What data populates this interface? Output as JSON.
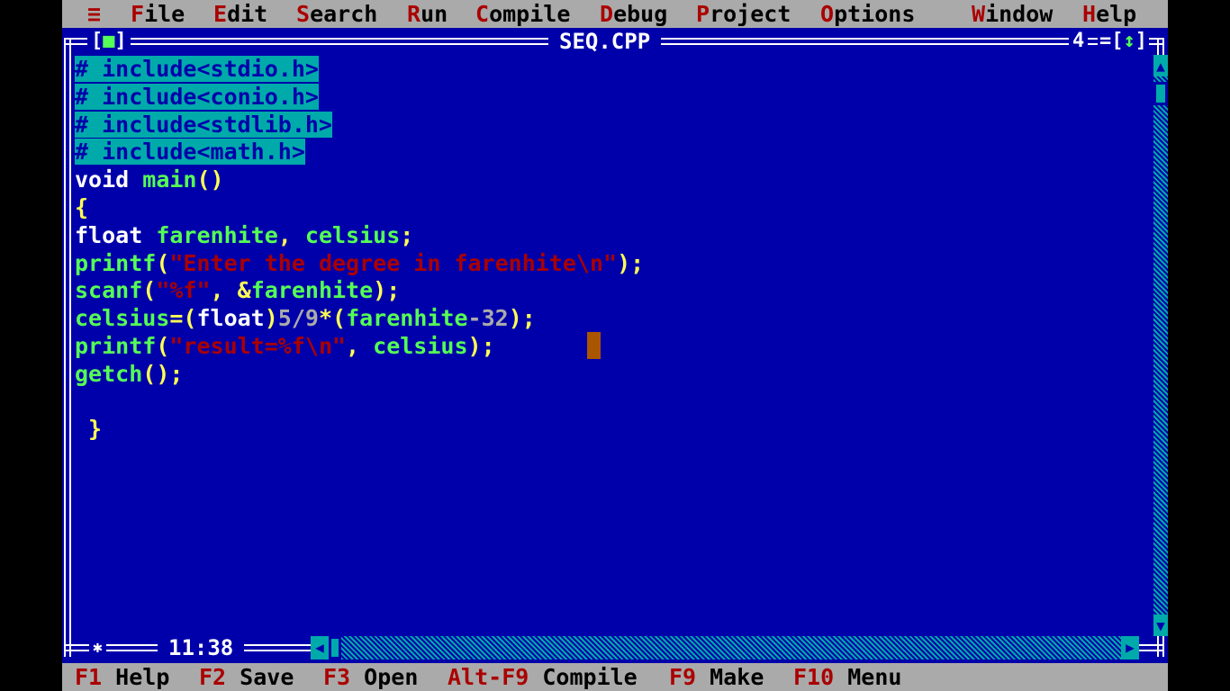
{
  "menu": {
    "system": "≡",
    "items": [
      {
        "hotkey": "F",
        "rest": "ile"
      },
      {
        "hotkey": "E",
        "rest": "dit"
      },
      {
        "hotkey": "S",
        "rest": "earch"
      },
      {
        "hotkey": "R",
        "rest": "un"
      },
      {
        "hotkey": "C",
        "rest": "ompile"
      },
      {
        "hotkey": "D",
        "rest": "ebug"
      },
      {
        "hotkey": "P",
        "rest": "roject"
      },
      {
        "hotkey": "O",
        "rest": "ptions"
      },
      {
        "hotkey": "W",
        "rest": "indow"
      },
      {
        "hotkey": "H",
        "rest": "elp"
      }
    ]
  },
  "window": {
    "title": "SEQ.CPP",
    "close_box_left": "[",
    "close_box_glyph": "■",
    "close_box_right": "]",
    "number": "4",
    "zoom_left": "=[",
    "zoom_glyph": "↕",
    "zoom_right": "]",
    "cursor_position": "11:38",
    "modified_mark": "✱"
  },
  "code": {
    "lines": [
      [
        {
          "t": "# include<stdio.h>",
          "c": "sel"
        }
      ],
      [
        {
          "t": "# include<conio.h>",
          "c": "sel"
        }
      ],
      [
        {
          "t": "# include<stdlib.h>",
          "c": "sel"
        }
      ],
      [
        {
          "t": "# include<math.h>",
          "c": "sel"
        }
      ],
      [
        {
          "t": "void",
          "c": "kw"
        },
        {
          "t": " ",
          "c": "kw"
        },
        {
          "t": "main",
          "c": "id"
        },
        {
          "t": "()",
          "c": "pn"
        }
      ],
      [
        {
          "t": "{",
          "c": "pn"
        }
      ],
      [
        {
          "t": "float",
          "c": "kw"
        },
        {
          "t": " ",
          "c": "kw"
        },
        {
          "t": "farenhite",
          "c": "id"
        },
        {
          "t": ", ",
          "c": "pn"
        },
        {
          "t": "celsius",
          "c": "id"
        },
        {
          "t": ";",
          "c": "pn"
        }
      ],
      [
        {
          "t": "printf",
          "c": "id"
        },
        {
          "t": "(",
          "c": "pn"
        },
        {
          "t": "\"Enter the degree in farenhite\\n\"",
          "c": "st"
        },
        {
          "t": ");",
          "c": "pn"
        }
      ],
      [
        {
          "t": "scanf",
          "c": "id"
        },
        {
          "t": "(",
          "c": "pn"
        },
        {
          "t": "\"%f\"",
          "c": "st"
        },
        {
          "t": ", &",
          "c": "pn"
        },
        {
          "t": "farenhite",
          "c": "id"
        },
        {
          "t": ");",
          "c": "pn"
        }
      ],
      [
        {
          "t": "celsius",
          "c": "id"
        },
        {
          "t": "=(",
          "c": "pn"
        },
        {
          "t": "float",
          "c": "kw"
        },
        {
          "t": ")",
          "c": "pn"
        },
        {
          "t": "5/9",
          "c": "nm"
        },
        {
          "t": "*(",
          "c": "pn"
        },
        {
          "t": "farenhite",
          "c": "id"
        },
        {
          "t": "-32",
          "c": "nm"
        },
        {
          "t": ");",
          "c": "pn"
        }
      ],
      [
        {
          "t": "printf",
          "c": "id"
        },
        {
          "t": "(",
          "c": "pn"
        },
        {
          "t": "\"result=%f\\n\"",
          "c": "st"
        },
        {
          "t": ", ",
          "c": "pn"
        },
        {
          "t": "celsius",
          "c": "id"
        },
        {
          "t": ");",
          "c": "pn"
        }
      ],
      [
        {
          "t": "getch",
          "c": "id"
        },
        {
          "t": "();",
          "c": "pn"
        }
      ],
      [],
      [
        {
          "t": " }",
          "c": "pn"
        }
      ]
    ]
  },
  "fkeys": [
    {
      "key": "F1",
      "label": "Help"
    },
    {
      "key": "F2",
      "label": "Save"
    },
    {
      "key": "F3",
      "label": "Open"
    },
    {
      "key": "Alt-F9",
      "label": "Compile"
    },
    {
      "key": "F9",
      "label": "Make"
    },
    {
      "key": "F10",
      "label": "Menu"
    }
  ],
  "colors": {
    "background": "#0000aa",
    "menu_bar": "#aaaaaa",
    "hotkey": "#aa0000",
    "selection": "#00aaaa",
    "keyword": "#ffffff",
    "identifier": "#55ff55",
    "punctuation": "#ffff55",
    "string": "#aa0000",
    "number": "#aaaaaa",
    "caret": "#aa5500"
  },
  "scrollbar_icons": {
    "up": "arrow-up-icon",
    "down": "arrow-down-icon",
    "left": "arrow-left-icon",
    "right": "arrow-right-icon"
  }
}
